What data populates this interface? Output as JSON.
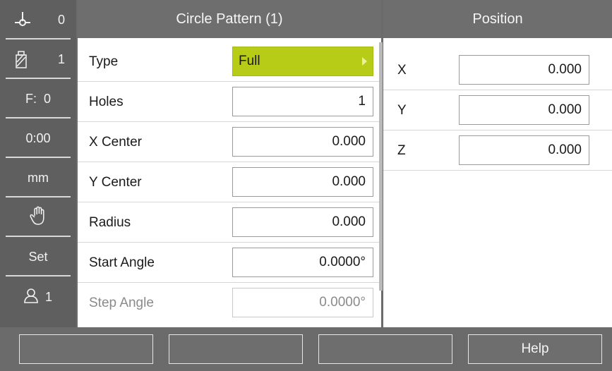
{
  "statusbar": {
    "datum": "0",
    "tool": "1",
    "feed": "F:  0",
    "time": "0:00",
    "unit": "mm",
    "mode_icon": "hand-icon",
    "set": "Set",
    "user": "1"
  },
  "form": {
    "title": "Circle Pattern (1)",
    "rows": [
      {
        "label": "Type",
        "value": "Full"
      },
      {
        "label": "Holes",
        "value": "1"
      },
      {
        "label": "X Center",
        "value": "0.000"
      },
      {
        "label": "Y Center",
        "value": "0.000"
      },
      {
        "label": "Radius",
        "value": "0.000"
      },
      {
        "label": "Start Angle",
        "value": "0.0000°"
      },
      {
        "label": "Step Angle",
        "value": "0.0000°"
      }
    ]
  },
  "position": {
    "title": "Position",
    "axes": [
      {
        "label": "X",
        "value": "0.000"
      },
      {
        "label": "Y",
        "value": "0.000"
      },
      {
        "label": "Z",
        "value": "0.000"
      }
    ]
  },
  "softkeys": [
    "",
    "",
    "",
    "Help"
  ],
  "colors": {
    "accent": "#b7cc16",
    "frame": "#6b6b6b",
    "header": "#6e6e6e"
  }
}
